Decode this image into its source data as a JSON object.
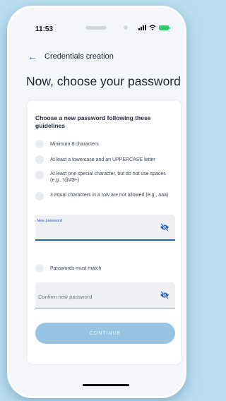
{
  "status": {
    "time": "11:53"
  },
  "nav": {
    "back_icon": "arrow-left-icon",
    "title": "Credentials creation"
  },
  "page": {
    "title": "Now, choose your password"
  },
  "card": {
    "heading": "Choose a new password following these guidelines",
    "rules": [
      {
        "text": "Minimum 8 characters"
      },
      {
        "text": "At least a lowercase and an UPPERCASE letter"
      },
      {
        "text": "At least one special character, but do not use spaces (e.g., !@#$+)"
      },
      {
        "text": "3 equal characters in a row are not allowed (e.g., aaa)"
      }
    ],
    "new_password": {
      "label": "New password",
      "value": "",
      "icon": "eye-slash-icon"
    },
    "match_rule": {
      "text": "Passwords must match"
    },
    "confirm_password": {
      "placeholder": "Confirm new password",
      "value": "",
      "icon": "eye-slash-icon"
    },
    "continue_label": "CONTINUE"
  },
  "colors": {
    "accent": "#1e5fbf",
    "button_disabled": "#98c3e3",
    "background": "#b9def0"
  }
}
